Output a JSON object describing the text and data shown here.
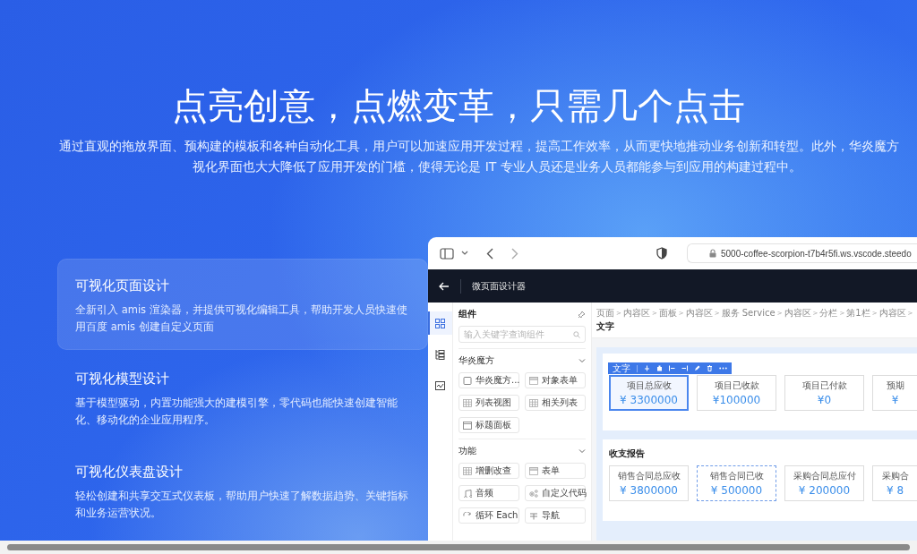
{
  "headline": "点亮创意，点燃变革，只需几个点击",
  "intro": [
    "通过直观的拖放界面、预构建的模板和各种自动化工具，用户可以加速应用开发过程，提高工作效率，从而更快地推动业务创新和转型。此外，华炎魔方",
    "视化界面也大大降低了应用开发的门槛，使得无论是 IT 专业人员还是业务人员都能参与到应用的构建过程中。"
  ],
  "features": [
    {
      "title": "可视化页面设计",
      "description": "全新引入 amis 渲染器，并提供可视化编辑工具，帮助开发人员快速使用百度 amis 创建自定义页面",
      "selected": true
    },
    {
      "title": "可视化模型设计",
      "description": "基于模型驱动，内置功能强大的建模引擎，零代码也能快速创建智能化、移动化的企业应用程序。",
      "selected": false
    },
    {
      "title": "可视化仪表盘设计",
      "description": "轻松创建和共享交互式仪表板，帮助用户快速了解数据趋势、关键指标和业务运营状况。",
      "selected": false
    }
  ],
  "browser": {
    "url": "5000-coffee-scorpion-t7b4r5fi.ws.vscode.steedo",
    "app_title": "微页面设计器",
    "rail": [
      {
        "kind": "grid",
        "selected": true
      },
      {
        "kind": "tree",
        "selected": false
      },
      {
        "kind": "chart",
        "selected": false
      }
    ],
    "panel": {
      "title": "组件",
      "search": {
        "placeholder": "输入关键字查询组件"
      },
      "groups": [
        {
          "name": "华炎魔方",
          "expanded": true,
          "items": [
            {
              "label": "华炎魔方...",
              "kind": "checkbox"
            },
            {
              "label": "对象表单",
              "kind": "form"
            },
            {
              "label": "列表视图",
              "kind": "table"
            },
            {
              "label": "相关列表",
              "kind": "table"
            },
            {
              "label": "标题面板",
              "kind": "panel"
            }
          ]
        },
        {
          "name": "功能",
          "expanded": true,
          "items": [
            {
              "label": "增删改查",
              "kind": "table"
            },
            {
              "label": "表单",
              "kind": "form"
            },
            {
              "label": "音频",
              "kind": "music"
            },
            {
              "label": "自定义代码",
              "kind": "code"
            },
            {
              "label": "循环 Each",
              "kind": "loop"
            },
            {
              "label": "导航",
              "kind": "nav"
            }
          ]
        }
      ]
    },
    "breadcrumb": [
      {
        "label": "页面",
        "current": false
      },
      {
        "separator": ">",
        "label": "内容区",
        "current": false
      },
      {
        "separator": ">",
        "label": "面板",
        "current": false
      },
      {
        "separator": ">",
        "label": "内容区",
        "current": false
      },
      {
        "separator": ">",
        "label": "服务 Service",
        "current": false
      },
      {
        "separator": ">",
        "label": "内容区",
        "current": false
      },
      {
        "separator": ">",
        "label": "分栏",
        "current": false
      },
      {
        "separator": ">",
        "label": "第1栏",
        "current": false
      },
      {
        "separator": ">",
        "label": "内容区",
        "current": false
      },
      {
        "separator": ">",
        "label": "文字",
        "current": true
      }
    ],
    "selection_toolbar": {
      "label": "文字"
    },
    "sections": [
      {
        "cards": [
          {
            "label": "项目总应收",
            "value": "¥ 3300000",
            "selected": true,
            "hovered": false
          },
          {
            "label": "项目已收款",
            "value": "¥100000",
            "selected": false,
            "hovered": false
          },
          {
            "label": "项目已付款",
            "value": "¥0",
            "selected": false,
            "hovered": false
          },
          {
            "label": "预期",
            "value": "¥",
            "selected": false,
            "hovered": false
          }
        ]
      },
      {
        "title": "收支报告",
        "cards": [
          {
            "label": "销售合同总应收",
            "value": "¥ 3800000",
            "selected": false,
            "hovered": false
          },
          {
            "label": "销售合同已收",
            "value": "¥ 500000",
            "selected": false,
            "hovered": true
          },
          {
            "label": "采购合同总应付",
            "value": "¥ 200000",
            "selected": false,
            "hovered": false
          },
          {
            "label": "采购合",
            "value": "¥ 8",
            "selected": false,
            "hovered": false
          }
        ]
      }
    ]
  }
}
